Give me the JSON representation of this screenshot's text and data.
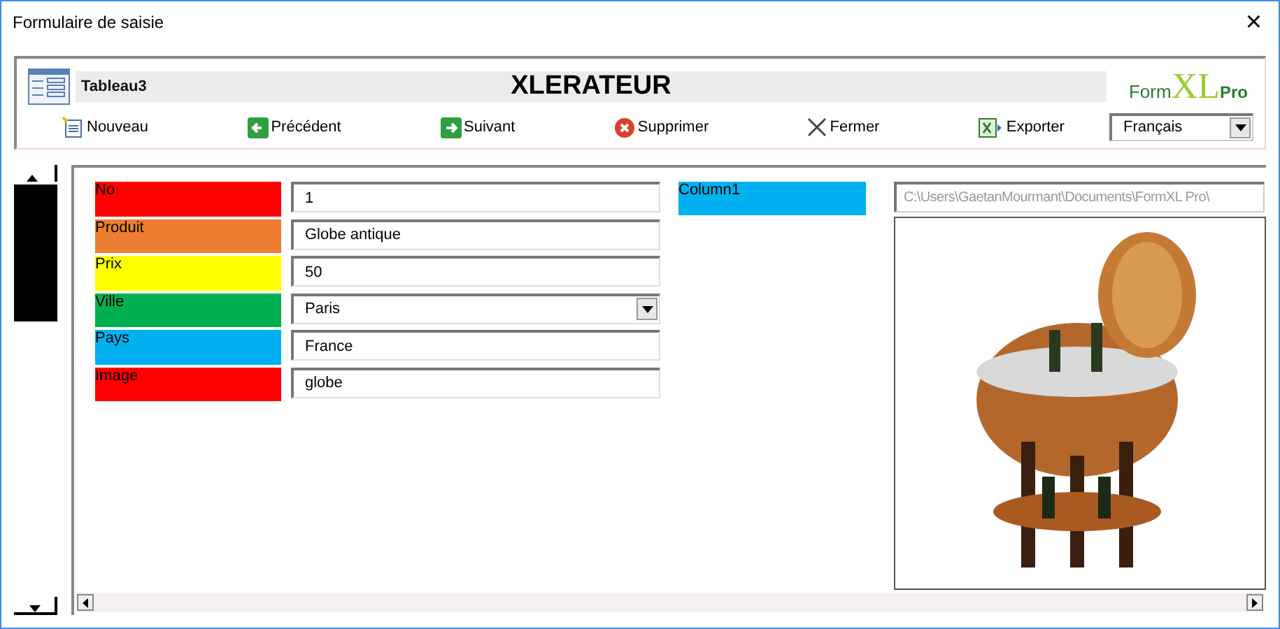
{
  "window": {
    "title": "Formulaire de saisie",
    "close": "×"
  },
  "header": {
    "table_name": "Tableau3",
    "title": "XLERATEUR",
    "logo": {
      "form": "Form",
      "xl": "XL",
      "pro": "Pro"
    }
  },
  "toolbar": [
    {
      "kind": "new",
      "label": "Nouveau"
    },
    {
      "kind": "prev",
      "label": "Précédent"
    },
    {
      "kind": "next",
      "label": "Suivant"
    },
    {
      "kind": "delete",
      "label": "Supprimer"
    },
    {
      "kind": "close",
      "label": "Fermer"
    },
    {
      "kind": "export",
      "label": "Exporter"
    }
  ],
  "language": {
    "value": "Français"
  },
  "fields": [
    {
      "label": "No",
      "color": "#ff0000",
      "kind": "text",
      "value": "1"
    },
    {
      "label": "Produit",
      "color": "#ed7d31",
      "kind": "text",
      "value": "Globe antique"
    },
    {
      "label": "Prix",
      "color": "#ffff00",
      "kind": "text",
      "value": "50"
    },
    {
      "label": "Ville",
      "color": "#00b050",
      "kind": "select",
      "value": "Paris"
    },
    {
      "label": "Pays",
      "color": "#00b0f0",
      "kind": "text",
      "value": "France"
    },
    {
      "label": "Image",
      "color": "#ff0000",
      "kind": "text",
      "value": "globe"
    }
  ],
  "image_column": {
    "label": "Column1",
    "color": "#00b0f0",
    "path": "C:\\Users\\GaetanMourmant\\Documents\\FormXL Pro\\"
  }
}
